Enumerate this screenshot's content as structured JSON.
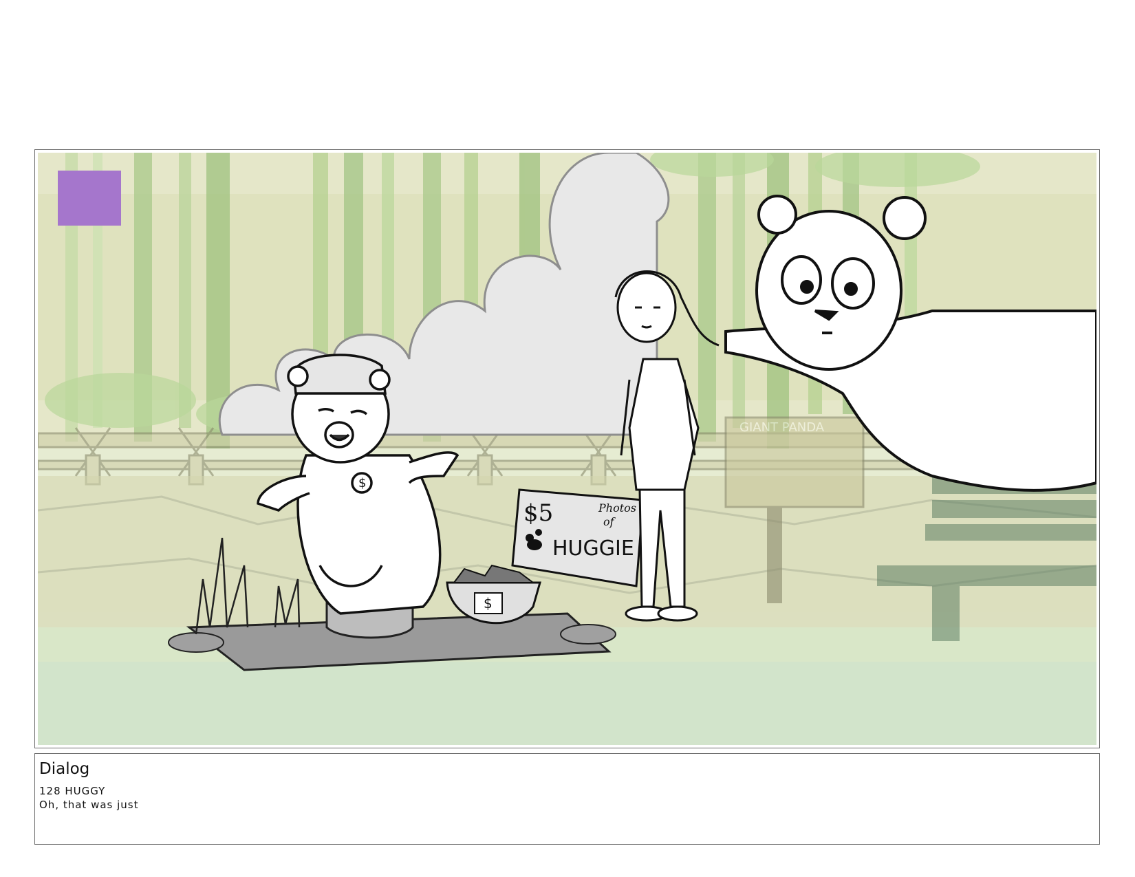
{
  "panel": {
    "marker_color": "#a576cc",
    "sign": {
      "price": "$5",
      "photos_line1": "Photos",
      "photos_line2": "of",
      "name": "HUGGIE"
    },
    "exhibit_sign": "GIANT PANDA",
    "bucket_symbol": "$",
    "medal_symbol": "$"
  },
  "dialog": {
    "title": "Dialog",
    "speaker_line": "128 HUGGY",
    "text": "Oh, that was just"
  }
}
